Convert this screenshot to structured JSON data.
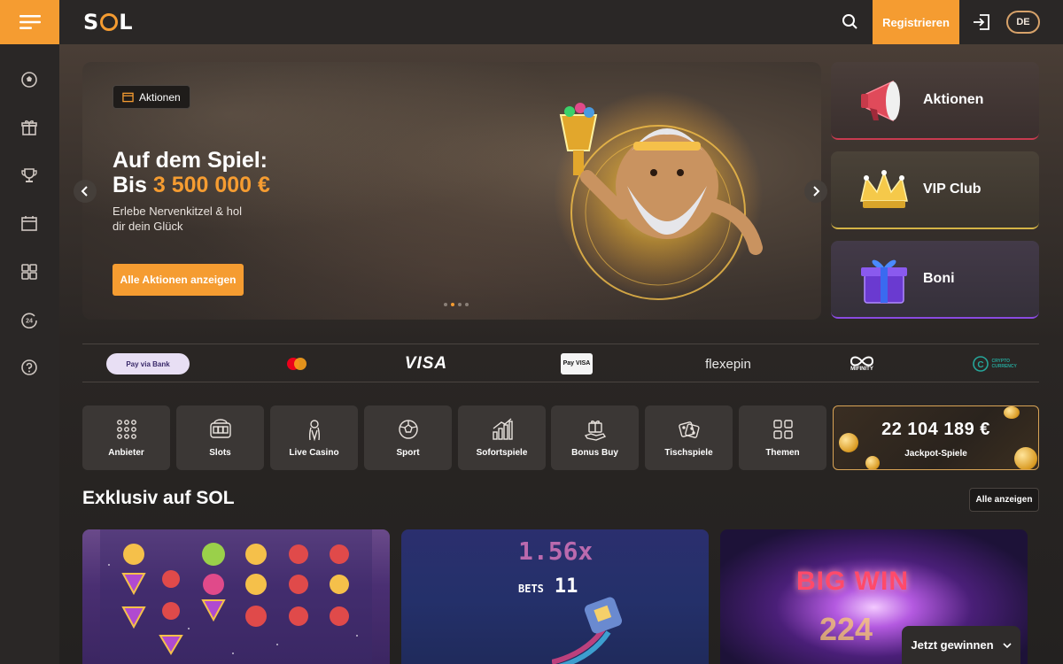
{
  "header": {
    "logo": "SOL",
    "register_label": "Registrieren",
    "language": "DE"
  },
  "sidebar": {
    "items": [
      {
        "icon": "soccer-icon"
      },
      {
        "icon": "gift-icon"
      },
      {
        "icon": "trophy-icon"
      },
      {
        "icon": "calendar-icon"
      },
      {
        "icon": "grid-icon"
      },
      {
        "icon": "support-24-icon"
      },
      {
        "icon": "help-icon"
      }
    ]
  },
  "hero": {
    "badge": "Aktionen",
    "title_line1": "Auf dem Spiel:",
    "title_prefix": "Bis",
    "title_amount": "3 500 000 €",
    "subtitle": "Erlebe Nervenkitzel & hol dir dein Glück",
    "cta": "Alle Aktionen anzeigen",
    "slide_count": 4,
    "active_slide": 2
  },
  "promos": [
    {
      "label": "Aktionen",
      "icon": "megaphone-icon",
      "accent": "#e0415a"
    },
    {
      "label": "VIP Club",
      "icon": "crown-icon",
      "accent": "#e0c040"
    },
    {
      "label": "Boni",
      "icon": "gift-box-icon",
      "accent": "#8a4ae0"
    }
  ],
  "payments": [
    {
      "name": "Pay via Bank",
      "icon": "pay-via-bank-logo"
    },
    {
      "name": "Mastercard",
      "icon": "mastercard-logo"
    },
    {
      "name": "VISA",
      "icon": "visa-logo"
    },
    {
      "name": "Pay VISA",
      "icon": "apple-pay-logo"
    },
    {
      "name": "flexepin",
      "icon": "flexepin-logo"
    },
    {
      "name": "MIFINITY",
      "icon": "mifinity-logo"
    },
    {
      "name": "CRYPTO CURRENCY",
      "icon": "crypto-logo"
    }
  ],
  "categories": [
    {
      "label": "Anbieter",
      "icon": "providers-icon"
    },
    {
      "label": "Slots",
      "icon": "slots-icon"
    },
    {
      "label": "Live Casino",
      "icon": "live-casino-icon"
    },
    {
      "label": "Sport",
      "icon": "sport-icon"
    },
    {
      "label": "Sofortspiele",
      "icon": "instant-games-icon"
    },
    {
      "label": "Bonus Buy",
      "icon": "bonus-buy-icon"
    },
    {
      "label": "Tischspiele",
      "icon": "table-games-icon"
    },
    {
      "label": "Themen",
      "icon": "themes-icon"
    }
  ],
  "jackpot": {
    "amount": "22 104 189 €",
    "label": "Jackpot-Spiele"
  },
  "section": {
    "title": "Exklusiv auf SOL",
    "show_all": "Alle anzeigen"
  },
  "games": [
    {
      "art_text": "",
      "icon": "gem-slot-art"
    },
    {
      "multiplier": "1.56x",
      "bets_label": "BETS",
      "bets_value": "11"
    },
    {
      "big_text": "BIG WIN",
      "big_number": "224"
    }
  ],
  "win_button": {
    "label": "Jetzt gewinnen"
  }
}
